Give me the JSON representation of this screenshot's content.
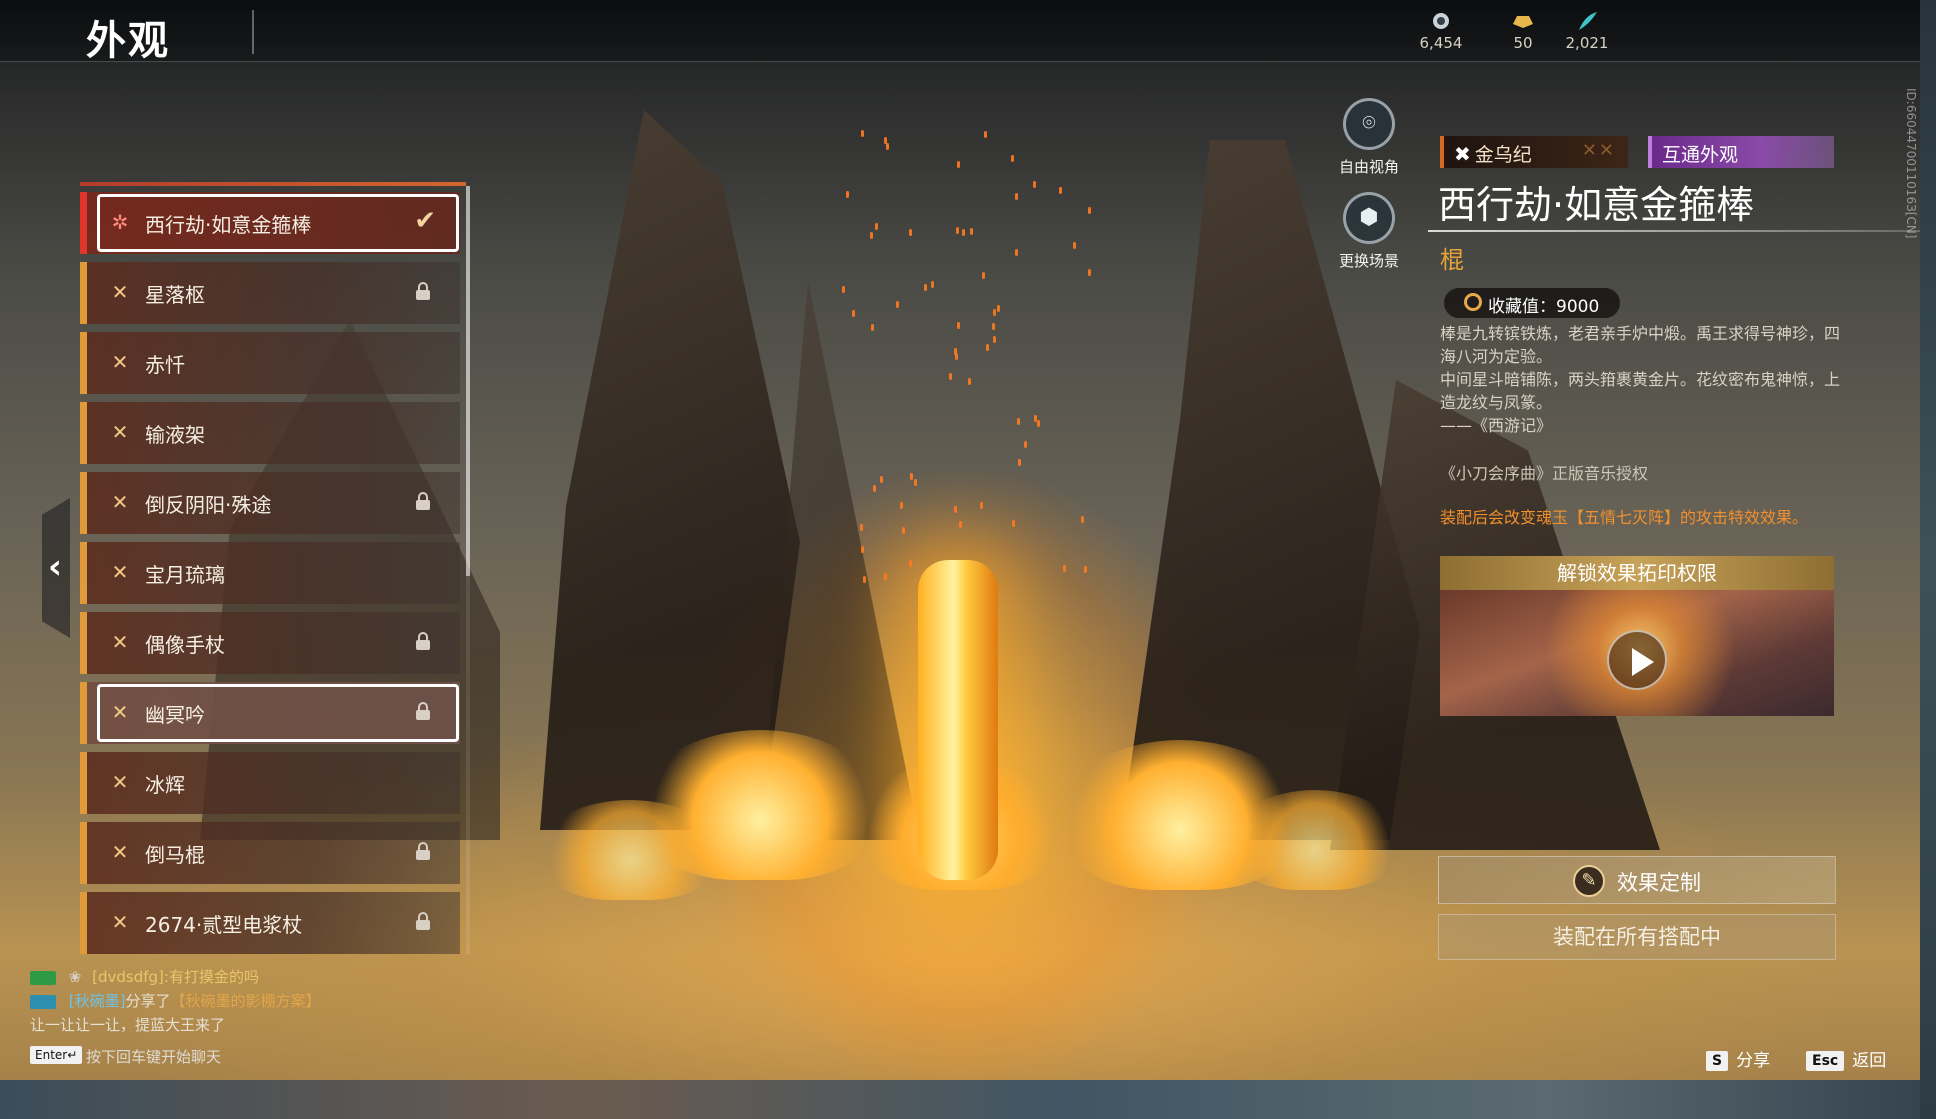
{
  "header": {
    "title": "外观",
    "currencies": [
      {
        "icon": "spirit-jade-icon",
        "value": "6,454"
      },
      {
        "icon": "gold-ingot-icon",
        "value": "50"
      },
      {
        "icon": "feather-icon",
        "value": "2,021"
      }
    ]
  },
  "camera": {
    "free_view_label": "自由视角",
    "change_scene_label": "更换场景"
  },
  "skin_list": {
    "items": [
      {
        "label": "西行劫·如意金箍棒",
        "locked": false,
        "state": "selected"
      },
      {
        "label": "星落枢",
        "locked": true,
        "state": ""
      },
      {
        "label": "赤忏",
        "locked": false,
        "state": ""
      },
      {
        "label": "输液架",
        "locked": false,
        "state": ""
      },
      {
        "label": "倒反阴阳·殊途",
        "locked": true,
        "state": ""
      },
      {
        "label": "宝月琉璃",
        "locked": false,
        "state": ""
      },
      {
        "label": "偶像手杖",
        "locked": true,
        "state": ""
      },
      {
        "label": "幽冥吟",
        "locked": true,
        "state": "hovered"
      },
      {
        "label": "冰辉",
        "locked": false,
        "state": ""
      },
      {
        "label": "倒马棍",
        "locked": true,
        "state": ""
      },
      {
        "label": "2674·贰型电浆杖",
        "locked": true,
        "state": ""
      }
    ]
  },
  "detail": {
    "series_tag": "金乌纪",
    "shared_tag": "互通外观",
    "title": "西行劫·如意金箍棒",
    "weapon_type": "棍",
    "collection_value": "收藏值：9000",
    "description": [
      "棒是九转镔铁炼，老君亲手炉中煅。禹王求得号神珍，四海八河为定验。",
      "中间星斗暗铺陈，两头箝裹黄金片。花纹密布鬼神惊，上造龙纹与凤篆。",
      "——《西游记》"
    ],
    "music_credit": "《小刀会序曲》正版音乐授权",
    "effect_note": "装配后会改变魂玉【五情七灭阵】的攻击特效效果。",
    "unlock_header": "解锁效果拓印权限",
    "customize_label": "效果定制",
    "equip_all_label": "装配在所有搭配中",
    "side_id": "ID:6604470011016З[CN]"
  },
  "chat": {
    "lines": [
      {
        "name": "[dvdsdfg]",
        "text": ":有打摸金的吗"
      },
      {
        "name": "[秋碗墨]",
        "text": "分享了",
        "link": "【秋碗墨的影棚方案】"
      },
      {
        "name": "",
        "text": "让一让让一让，提蓝大王来了"
      }
    ],
    "hint_key": "Enter↵",
    "hint": "按下回车键开始聊天"
  },
  "footer": {
    "share_key": "S",
    "share_label": "分享",
    "back_key": "Esc",
    "back_label": "返回"
  },
  "colors": {
    "accent_gold": "#e7a33b",
    "selected_red": "#e0352a",
    "shared_purple": "#8a4aa8",
    "effect_orange": "#f0902e"
  }
}
